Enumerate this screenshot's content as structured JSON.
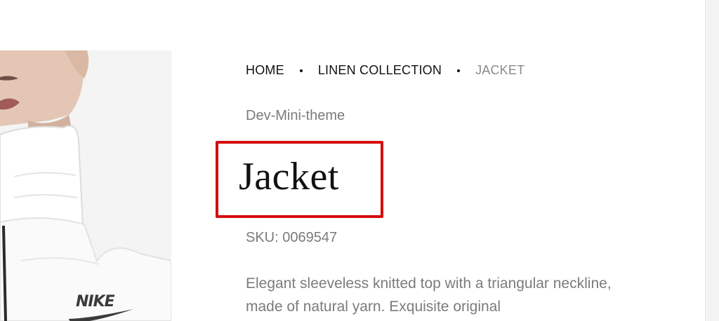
{
  "breadcrumb": {
    "home": "HOME",
    "collection": "LINEN COLLECTION",
    "current": "JACKET"
  },
  "product": {
    "vendor": "Dev-Mini-theme",
    "title": "Jacket",
    "sku_label": "SKU:",
    "sku_value": "0069547",
    "description": "Elegant sleeveless knitted top with a triangular neckline, made of natural yarn. Exquisite original",
    "image_brand_text": "NIKE"
  },
  "colors": {
    "highlight_border": "#d60d0d",
    "muted_text": "#7b7b7b",
    "main_text": "#111111"
  }
}
